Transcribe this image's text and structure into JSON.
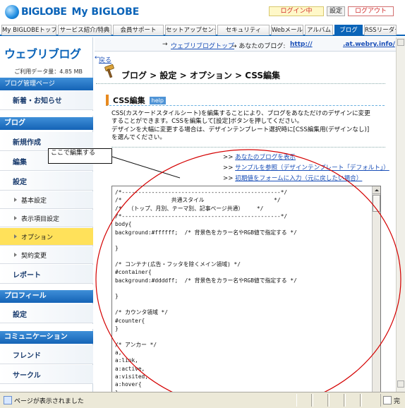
{
  "header": {
    "logo": "BIGLOBE",
    "logo_my": "My BIGLOBE",
    "login_status": "ログイン中",
    "settings_label": "設定",
    "logout_label": "ログアウト"
  },
  "tabs": [
    {
      "label": "My BIGLOBEトップ",
      "active": false
    },
    {
      "label": "サービス紹介/特典",
      "active": false
    },
    {
      "label": "会員サポート",
      "active": false
    },
    {
      "label": "セットアップセンター",
      "active": false
    },
    {
      "label": "セキュリティ",
      "active": false
    },
    {
      "label": "Webメール",
      "active": false
    },
    {
      "label": "アルバム",
      "active": false
    },
    {
      "label": "ブログ",
      "active": true
    },
    {
      "label": "RSSリーダー",
      "active": false
    }
  ],
  "sidebar": {
    "title": "ウェブリブログ",
    "usage": "ご利用データ量：4.85 MB",
    "manage_head": "ブログ管理ページ",
    "news": "新着・お知らせ",
    "blog_head": "ブログ",
    "blog_items": {
      "new_post": "新規作成",
      "edit": "編集",
      "settings": "設定",
      "basic_settings": "基本設定",
      "display_settings": "表示項目設定",
      "options": "オプション",
      "contract_change": "契約変更",
      "report": "レポート"
    },
    "profile_head": "プロフィール",
    "profile_settings": "設定",
    "community_head": "コミュニケーション",
    "friends": "フレンド",
    "circle": "サークル"
  },
  "breadcrumb_top": {
    "arrow": "→",
    "home_link": "ウェブリブログトップ",
    "your_blog": "→ あなたのブログ:",
    "blog_url": "http://",
    "blog_url_suffix": ".at.webry.info/"
  },
  "main": {
    "back_arrow": "←",
    "back": "戻る",
    "page_title": "ブログ > 設定 > オプション > CSS編集",
    "section_title": "CSS編集",
    "help": "help",
    "desc_lines": [
      "CSS(カスケードスタイルシート)を編集することにより、ブログをあなただけのデザインに変更",
      "することができます。CSSを編集して[設定]ボタンを押してください。",
      "デザインを大幅に変更する場合は、デザインテンプレート選択時に[CSS編集用(デザインなし)]",
      "を選んでください。"
    ],
    "links": [
      {
        "prefix": ">>",
        "text": "あなたのブログを表示"
      },
      {
        "prefix": ">>",
        "text": "サンプルを参照（デザインテンプレート「デフォルト」）"
      },
      {
        "prefix": ">>",
        "text": "初期値をフォームに入力（元に戻したい場合）"
      }
    ],
    "annotation": "ここで編集する",
    "css_text": "/*------------------------------------------------*/\n/*               共通スタイル                     */\n/*  （トップ、月別、テーマ別、記事ページ共通）    */\n/*------------------------------------------------*/\nbody{\nbackground:#ffffff;  /* 背景色をカラー名やRGB値で指定する */\n\n}\n\n/* コンテナ(広告・フッタを除くメイン領域) */\n#container{\nbackground:#ddddff;  /* 背景色をカラー名やRGB値で指定する */\n\n}\n\n/* カウンタ領域 */\n#counter{\n}\n\n/* アンカー */\na,\na:link,\na:active,\na:visited,\na:hover{\n}\n\n/*-------------- ページロック領域 --------------*/"
  },
  "status_bar": {
    "text": "ページが表示されました",
    "zone": "完"
  }
}
